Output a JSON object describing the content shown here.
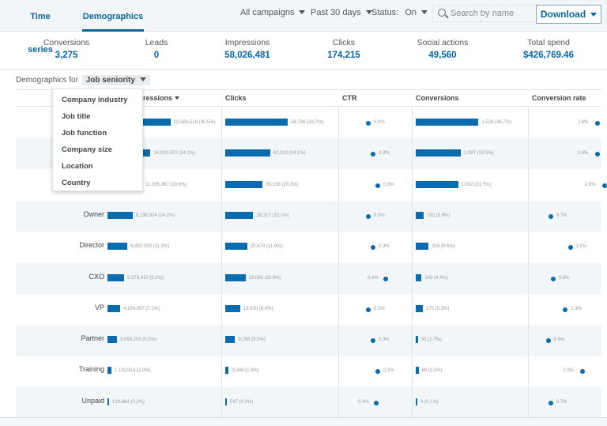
{
  "tabs": [
    {
      "label": "Time series",
      "active": false
    },
    {
      "label": "Demographics",
      "active": true
    }
  ],
  "filters": {
    "campaigns": "All campaigns",
    "date_range": "Past 30 days",
    "status_label": "Status:",
    "status_value": "On"
  },
  "search": {
    "placeholder": "Search by name",
    "icon": "search-icon"
  },
  "download": {
    "label": "Download"
  },
  "summary": [
    {
      "label": "Conversions",
      "value": "3,275"
    },
    {
      "label": "Leads",
      "value": "0"
    },
    {
      "label": "Impressions",
      "value": "58,026,481"
    },
    {
      "label": "Clicks",
      "value": "174,215"
    },
    {
      "label": "Social actions",
      "value": "49,560"
    },
    {
      "label": "Total spend",
      "value": "$426,769.46"
    }
  ],
  "demographics_for": {
    "label": "Demographics for",
    "selected": "Job seniority"
  },
  "dropdown_options": [
    "Company industry",
    "Job title",
    "Job function",
    "Company size",
    "Location",
    "Country"
  ],
  "columns": {
    "impressions": "Impressions",
    "clicks": "Clicks",
    "ctr": "CTR",
    "conversions": "Conversions",
    "conversion_rate": "Conversion rate"
  },
  "colors": {
    "accent": "#0a66a2",
    "bar": "#0a6bae",
    "alt_row": "#f3f6f8"
  },
  "rows": [
    {
      "label": "",
      "impressions": "20,588,518 (35.5%)",
      "imp_pct": 35.5,
      "clicks": "58,796 (33.7%)",
      "clk_pct": 33.7,
      "ctr": "0.3%",
      "ctr_val": 0.3,
      "ctr_side": "right",
      "conversions": "1,528 (46.7%)",
      "conv_pct": 46.7,
      "conv_rate": "2.6%",
      "cr_val": 2.6,
      "cr_side": "left"
    },
    {
      "label": "",
      "impressions": "14,039,570 (24.2%)",
      "imp_pct": 24.2,
      "clicks": "42,010 (24.1%)",
      "clk_pct": 24.1,
      "ctr": "0.3%",
      "ctr_val": 0.3,
      "ctr_side": "right",
      "conversions": "1,097 (33.5%)",
      "conv_pct": 33.5,
      "conv_rate": "2.6%",
      "cr_val": 2.6,
      "cr_side": "left"
    },
    {
      "label": "",
      "impressions": "11,396,367 (19.6%)",
      "imp_pct": 19.6,
      "clicks": "35,138 (20.2%)",
      "clk_pct": 20.2,
      "ctr": "0.3%",
      "ctr_val": 0.3,
      "ctr_side": "right",
      "conversions": "1,032 (31.5%)",
      "conv_pct": 31.5,
      "conv_rate": "2.9%",
      "cr_val": 2.9,
      "cr_side": "left"
    },
    {
      "label": "Owner",
      "impressions": "8,236,924 (14.2%)",
      "imp_pct": 14.2,
      "clicks": "26,317 (15.1%)",
      "clk_pct": 15.1,
      "ctr": "0.3%",
      "ctr_val": 0.3,
      "ctr_side": "right",
      "conversions": "192 (5.9%)",
      "conv_pct": 5.9,
      "conv_rate": "0.7%",
      "cr_val": 0.7,
      "cr_side": "right"
    },
    {
      "label": "Director",
      "impressions": "6,492,093 (11.2%)",
      "imp_pct": 11.2,
      "clicks": "20,674 (11.9%)",
      "clk_pct": 11.9,
      "ctr": "0.3%",
      "ctr_val": 0.3,
      "ctr_side": "right",
      "conversions": "316 (9.6%)",
      "conv_pct": 9.6,
      "conv_rate": "1.5%",
      "cr_val": 1.5,
      "cr_side": "right"
    },
    {
      "label": "CXO",
      "impressions": "5,373,410 (9.3%)",
      "imp_pct": 9.3,
      "clicks": "19,060 (10.9%)",
      "clk_pct": 10.9,
      "ctr": "0.4%",
      "ctr_val": 0.4,
      "ctr_side": "left",
      "conversions": "143 (4.4%)",
      "conv_pct": 4.4,
      "conv_rate": "0.8%",
      "cr_val": 0.8,
      "cr_side": "right"
    },
    {
      "label": "VP",
      "impressions": "4,104,997 (7.1%)",
      "imp_pct": 7.1,
      "clicks": "13,930 (8.0%)",
      "clk_pct": 8.0,
      "ctr": "0.3%",
      "ctr_val": 0.3,
      "ctr_side": "right",
      "conversions": "175 (5.3%)",
      "conv_pct": 5.3,
      "conv_rate": "1.3%",
      "cr_val": 1.3,
      "cr_side": "right"
    },
    {
      "label": "Partner",
      "impressions": "3,068,202 (5.3%)",
      "imp_pct": 5.3,
      "clicks": "9,298 (5.3%)",
      "clk_pct": 5.3,
      "ctr": "0.3%",
      "ctr_val": 0.3,
      "ctr_side": "right",
      "conversions": "55 (1.7%)",
      "conv_pct": 1.7,
      "conv_rate": "0.6%",
      "cr_val": 0.6,
      "cr_side": "right"
    },
    {
      "label": "Training",
      "impressions": "1,133,914 (2.0%)",
      "imp_pct": 2.0,
      "clicks": "3,346 (1.9%)",
      "clk_pct": 1.9,
      "ctr": "0.3%",
      "ctr_val": 0.3,
      "ctr_side": "right",
      "conversions": "68 (2.1%)",
      "conv_pct": 2.1,
      "conv_rate": "2.0%",
      "cr_val": 2.0,
      "cr_side": "left"
    },
    {
      "label": "Unpaid",
      "impressions": "129,664 (0.2%)",
      "imp_pct": 0.2,
      "clicks": "547 (0.3%)",
      "clk_pct": 0.3,
      "ctr": "0.4%",
      "ctr_val": 0.4,
      "ctr_side": "left",
      "conversions": "4 (0.1%)",
      "conv_pct": 0.1,
      "conv_rate": "0.7%",
      "cr_val": 0.7,
      "cr_side": "right"
    }
  ]
}
